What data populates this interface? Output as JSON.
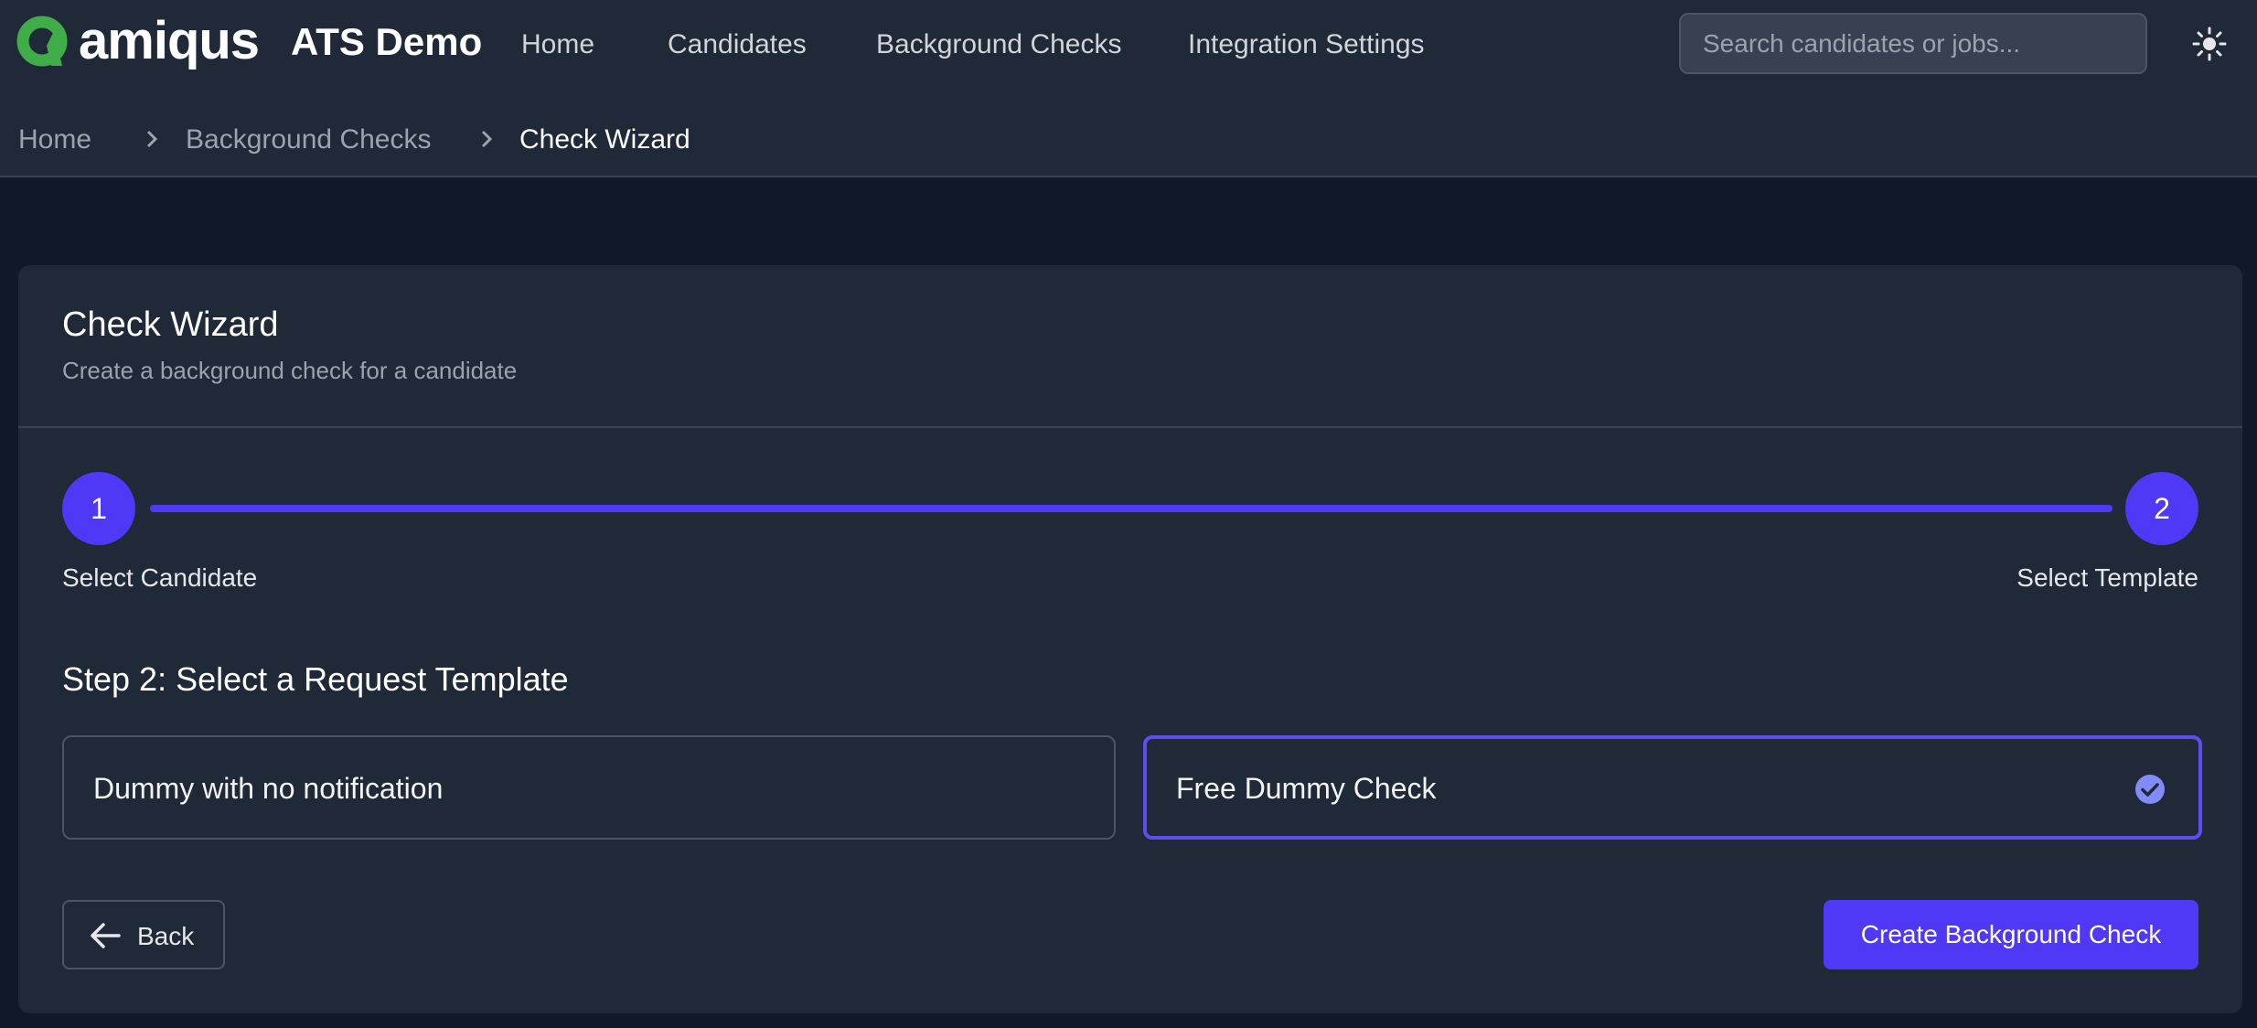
{
  "header": {
    "logo_text": "amiqus",
    "app_title": "ATS Demo",
    "nav": [
      "Home",
      "Candidates",
      "Background Checks",
      "Integration Settings"
    ],
    "search": {
      "placeholder": "Search candidates or jobs...",
      "value": ""
    },
    "theme_icon": "sun-icon"
  },
  "breadcrumb": [
    "Home",
    "Background Checks",
    "Check Wizard"
  ],
  "wizard": {
    "title": "Check Wizard",
    "subtitle": "Create a background check for a candidate",
    "steps": [
      {
        "number": "1",
        "label": "Select Candidate"
      },
      {
        "number": "2",
        "label": "Select Template"
      }
    ],
    "progress": 1.0,
    "section_title": "Step 2: Select a Request Template",
    "templates": [
      {
        "label": "Dummy with no notification",
        "selected": false
      },
      {
        "label": "Free Dummy Check",
        "selected": true
      }
    ],
    "back_label": "Back",
    "create_label": "Create Background Check"
  },
  "colors": {
    "accent": "#4f39f6",
    "logo_green": "#3fae49",
    "background": "#111827",
    "surface": "#1f2937"
  }
}
